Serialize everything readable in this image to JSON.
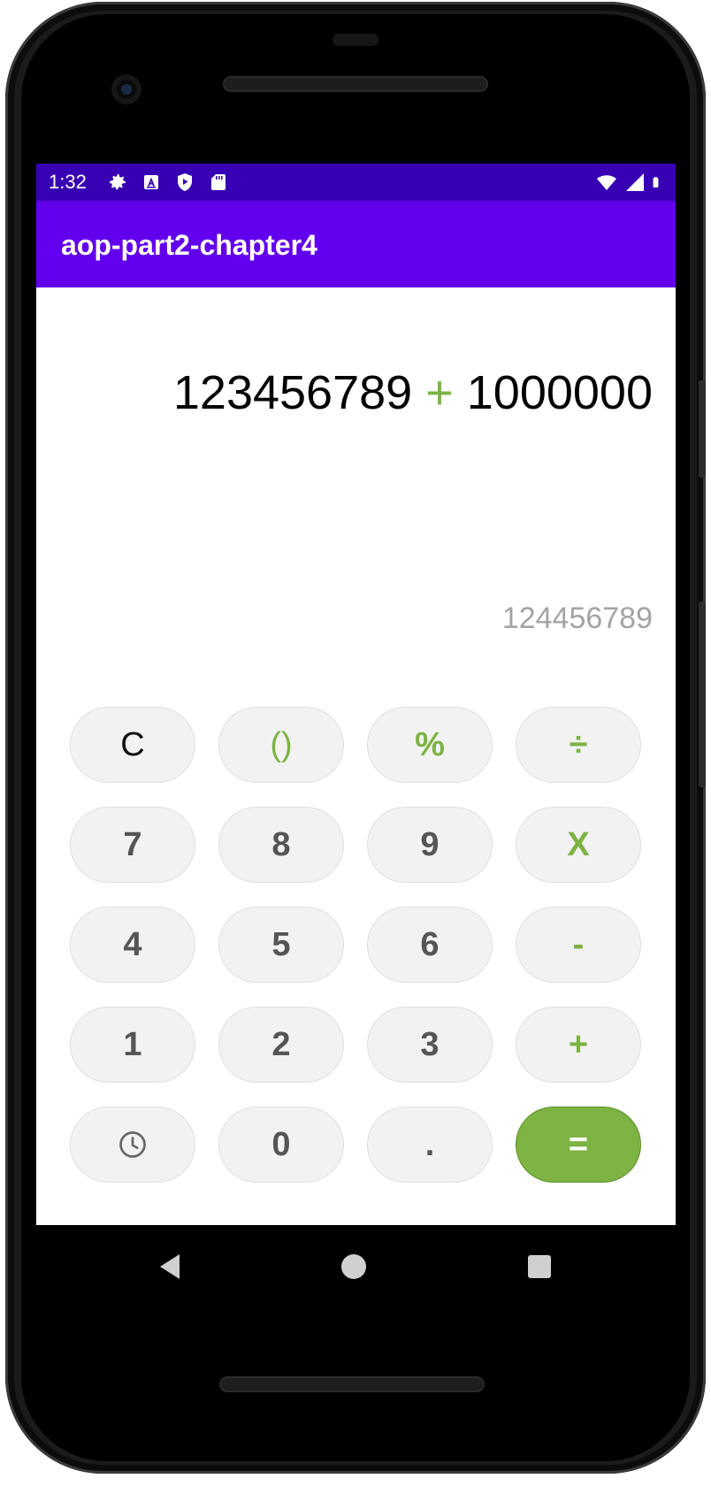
{
  "status_bar": {
    "time": "1:32",
    "left_icons": [
      "gear-icon",
      "a-box-icon",
      "shield-play-icon",
      "sd-card-icon"
    ],
    "right_icons": [
      "wifi-icon",
      "signal-icon",
      "battery-icon"
    ],
    "background": "#3700b3"
  },
  "app_bar": {
    "title": "aop-part2-chapter4",
    "background": "#6200ee"
  },
  "display": {
    "expression_left": "123456789",
    "expression_operator": "+",
    "expression_right": "1000000",
    "result": "124456789"
  },
  "keypad": {
    "row1": [
      "C",
      "()",
      "%",
      "÷"
    ],
    "row2": [
      "7",
      "8",
      "9",
      "X"
    ],
    "row3": [
      "4",
      "5",
      "6",
      "-"
    ],
    "row4": [
      "1",
      "2",
      "3",
      "+"
    ],
    "row5": [
      "history-icon",
      "0",
      ".",
      "="
    ]
  },
  "colors": {
    "accent_green": "#7cb342",
    "key_background": "#f2f2f2",
    "result_gray": "#a4a4a4"
  },
  "nav_bar": {
    "icons": [
      "back-icon",
      "home-icon",
      "recents-icon"
    ]
  }
}
